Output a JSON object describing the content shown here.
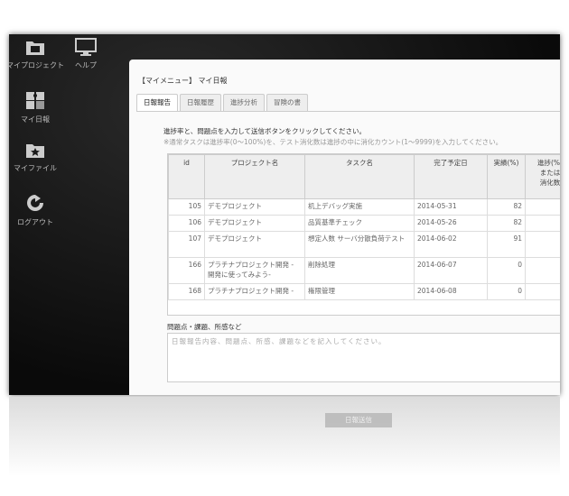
{
  "sidebar": {
    "items": [
      {
        "label": "マイプロジェクト",
        "icon": "folder-icon"
      },
      {
        "label": "ヘルプ",
        "icon": "monitor-icon"
      },
      {
        "label": "マイ日報",
        "icon": "puzzle-icon"
      },
      {
        "label": "マイファイル",
        "icon": "star-folder-icon"
      },
      {
        "label": "ログアウト",
        "icon": "logout-icon"
      }
    ]
  },
  "panel": {
    "title": "【マイメニュー】 マイ日報",
    "tabs": [
      "日報報告",
      "日報履歴",
      "進捗分析",
      "冒険の書"
    ],
    "instruction": "進捗率と、問題点を入力して送信ボタンをクリックしてください。",
    "note": "※通常タスクは進捗率(0〜100%)を、テスト消化数は進捗の中に消化カウント(1〜9999)を入力してください。"
  },
  "table": {
    "headers": [
      "id",
      "プロジェクト名",
      "タスク名",
      "完了予定日",
      "実績(%)",
      "進捗(%)\nまたは\n消化数"
    ],
    "rows": [
      {
        "id": "105",
        "project": "デモプロジェクト",
        "task": "机上デバッグ実施",
        "due": "2014-05-31",
        "actual": "82",
        "progress": ""
      },
      {
        "id": "106",
        "project": "デモプロジェクト",
        "task": "品質基準チェック",
        "due": "2014-05-26",
        "actual": "82",
        "progress": ""
      },
      {
        "id": "107",
        "project": "デモプロジェクト",
        "task": "想定人数 サーバ分散負荷テスト",
        "due": "2014-06-02",
        "actual": "91",
        "progress": ""
      },
      {
        "id": "166",
        "project": "プラチナプロジェクト開発 - 開発に使ってみよう-",
        "task": "削除処理",
        "due": "2014-06-07",
        "actual": "0",
        "progress": ""
      },
      {
        "id": "168",
        "project": "プラチナプロジェクト開発 -",
        "task": "権限管理",
        "due": "2014-06-08",
        "actual": "0",
        "progress": ""
      }
    ]
  },
  "issues": {
    "label": "問題点・課題、所感など",
    "placeholder": "日報報告内容、問題点、所感、課題などを記入してください。"
  },
  "submit": {
    "label": "日報送信",
    "icon": "pen-icon"
  },
  "colors": {
    "frame_bg": "#111111",
    "button_bg": "#222222"
  }
}
